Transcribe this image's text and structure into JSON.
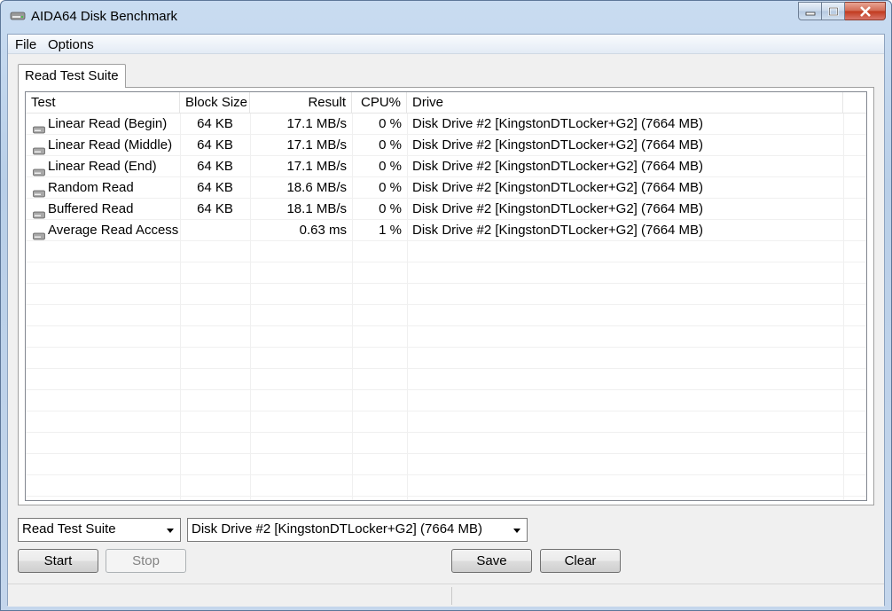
{
  "window": {
    "title": "AIDA64 Disk Benchmark"
  },
  "menu": {
    "file": "File",
    "options": "Options"
  },
  "tab": {
    "label": "Read Test Suite"
  },
  "table": {
    "headers": [
      "Test",
      "Block Size",
      "Result",
      "CPU%",
      "Drive"
    ],
    "rows": [
      {
        "test": "Linear Read (Begin)",
        "block": "64 KB",
        "result": "17.1 MB/s",
        "cpu": "0 %",
        "drive": "Disk Drive #2  [KingstonDTLocker+G2]  (7664 MB)"
      },
      {
        "test": "Linear Read (Middle)",
        "block": "64 KB",
        "result": "17.1 MB/s",
        "cpu": "0 %",
        "drive": "Disk Drive #2  [KingstonDTLocker+G2]  (7664 MB)"
      },
      {
        "test": "Linear Read (End)",
        "block": "64 KB",
        "result": "17.1 MB/s",
        "cpu": "0 %",
        "drive": "Disk Drive #2  [KingstonDTLocker+G2]  (7664 MB)"
      },
      {
        "test": "Random Read",
        "block": "64 KB",
        "result": "18.6 MB/s",
        "cpu": "0 %",
        "drive": "Disk Drive #2  [KingstonDTLocker+G2]  (7664 MB)"
      },
      {
        "test": "Buffered Read",
        "block": "64 KB",
        "result": "18.1 MB/s",
        "cpu": "0 %",
        "drive": "Disk Drive #2  [KingstonDTLocker+G2]  (7664 MB)"
      },
      {
        "test": "Average Read Access",
        "block": "",
        "result": "0.63 ms",
        "cpu": "1 %",
        "drive": "Disk Drive #2  [KingstonDTLocker+G2]  (7664 MB)"
      }
    ]
  },
  "controls": {
    "suite_select": "Read Test Suite",
    "drive_select": "Disk Drive #2  [KingstonDTLocker+G2]  (7664 MB)",
    "start": "Start",
    "stop": "Stop",
    "save": "Save",
    "clear": "Clear"
  },
  "icons": {
    "app": "hard-disk-icon",
    "row": "hard-disk-icon"
  }
}
